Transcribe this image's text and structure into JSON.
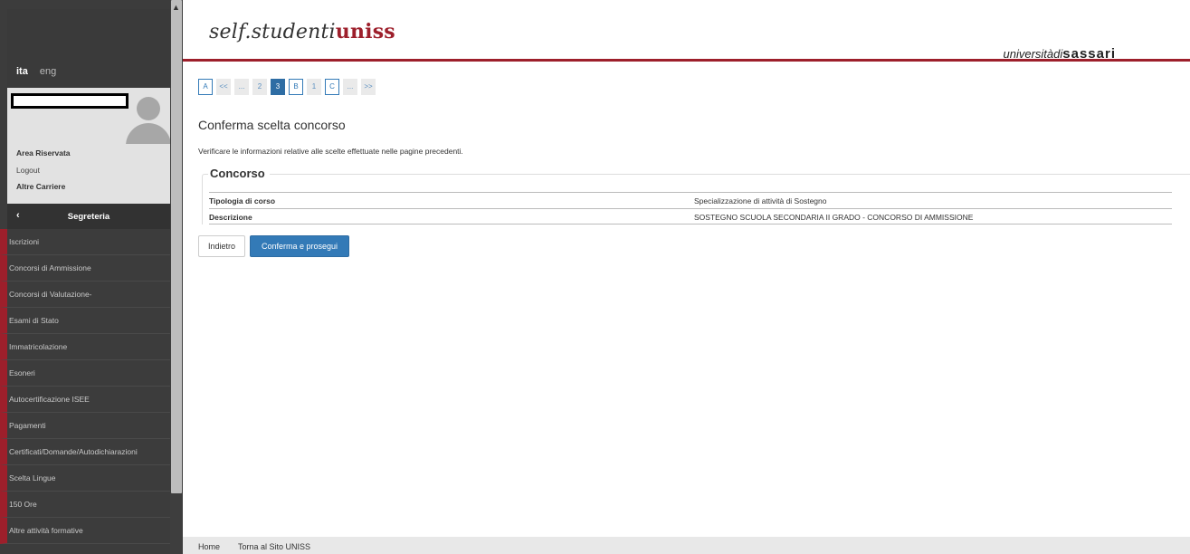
{
  "header": {
    "logo_prefix": "self.studenti",
    "logo_strong": "uniss",
    "university_prefix": "universitàdi",
    "university_name": "sassari"
  },
  "sidebar": {
    "lang_active": "ita",
    "lang_other": "eng",
    "user_links": [
      "Area Riservata",
      "Logout",
      "Altre Carriere"
    ],
    "menu_title": "Segreteria",
    "menu_back_glyph": "‹",
    "items": [
      "Iscrizioni",
      "Concorsi di Ammissione",
      "Concorsi di Valutazione-",
      "Esami di Stato",
      "Immatricolazione",
      "Esoneri",
      "Autocertificazione ISEE",
      "Pagamenti",
      "Certificati/Domande/Autodichiarazioni",
      "Scelta Lingue",
      "150 Ore",
      "Altre attività formative"
    ]
  },
  "pager": [
    {
      "label": "A",
      "kind": "outlined"
    },
    {
      "label": "<<",
      "kind": "plain"
    },
    {
      "label": "...",
      "kind": "plain"
    },
    {
      "label": "2",
      "kind": "plain"
    },
    {
      "label": "3",
      "kind": "current"
    },
    {
      "label": "B",
      "kind": "outlined"
    },
    {
      "label": "1",
      "kind": "plain"
    },
    {
      "label": "C",
      "kind": "outlined"
    },
    {
      "label": "...",
      "kind": "plain"
    },
    {
      "label": ">>",
      "kind": "plain"
    }
  ],
  "main": {
    "title": "Conferma scelta concorso",
    "intro": "Verificare le informazioni relative alle scelte effettuate nelle pagine precedenti.",
    "section_title": "Concorso",
    "rows": [
      {
        "key": "Tipologia di corso",
        "value": "Specializzazione di attività di Sostegno"
      },
      {
        "key": "Descrizione",
        "value": "SOSTEGNO SCUOLA SECONDARIA II GRADO - CONCORSO DI AMMISSIONE"
      }
    ],
    "back_label": "Indietro",
    "confirm_label": "Conferma e prosegui"
  },
  "footer": {
    "home": "Home",
    "site": "Torna al Sito UNISS"
  },
  "colors": {
    "brand_red": "#9d1f2b",
    "primary_blue": "#337ab7",
    "sidebar_bg": "#3c3c3c"
  }
}
